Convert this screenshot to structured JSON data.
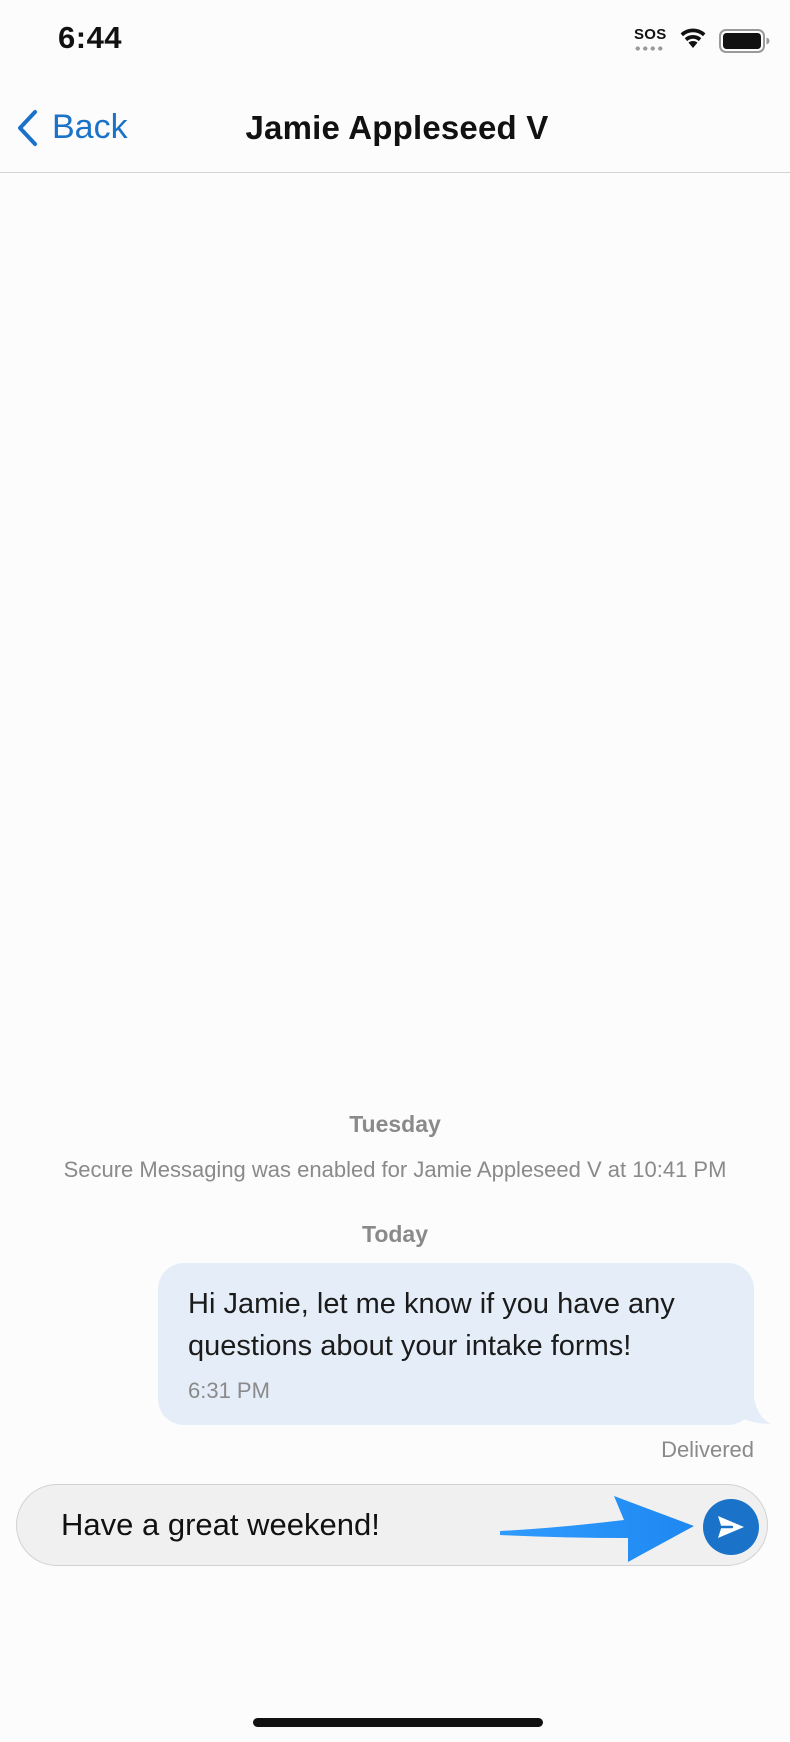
{
  "status_bar": {
    "time": "6:44",
    "sos": "SOS"
  },
  "nav": {
    "back_label": "Back",
    "title": "Jamie Appleseed V"
  },
  "conversation": {
    "day1": "Tuesday",
    "system_note": "Secure Messaging was enabled for Jamie Appleseed V at 10:41 PM",
    "day2": "Today",
    "message": {
      "text": "Hi Jamie, let me know if you have any questions about your intake forms!",
      "time": "6:31 PM",
      "status": "Delivered"
    }
  },
  "composer": {
    "value": "Have a great weekend!"
  },
  "colors": {
    "accent": "#1a73c8",
    "bubble": "#e5eef8",
    "annotation_arrow": "#1e90ff"
  },
  "icons": {
    "back": "chevron-left-icon",
    "send": "paper-plane-icon",
    "wifi": "wifi-icon",
    "battery": "battery-icon"
  }
}
